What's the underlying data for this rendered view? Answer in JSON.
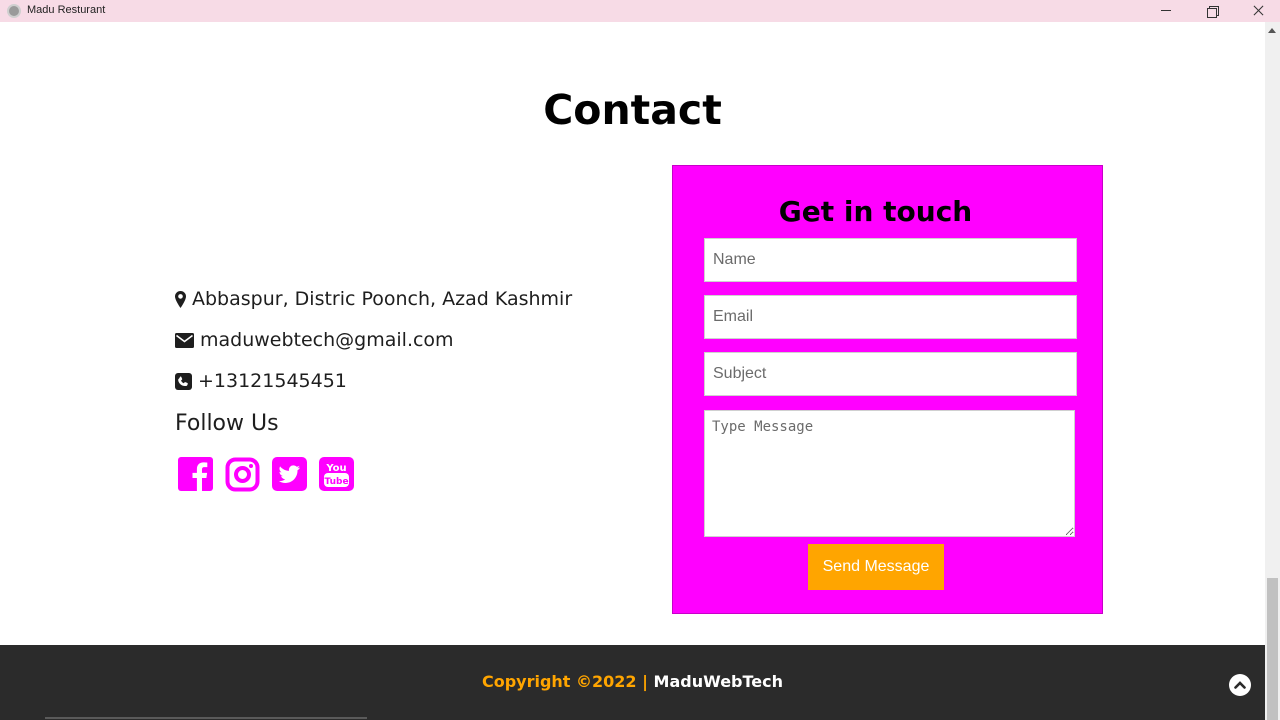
{
  "window": {
    "title": "Madu Resturant"
  },
  "page": {
    "heading": "Contact"
  },
  "contact": {
    "address": "Abbaspur, Distric Poonch, Azad Kashmir",
    "email": "maduwebtech@gmail.com",
    "phone": "+13121545451",
    "follow_title": "Follow Us",
    "socials": [
      {
        "name": "Facebook",
        "icon": "facebook-icon"
      },
      {
        "name": "Instagram",
        "icon": "instagram-icon"
      },
      {
        "name": "Twitter",
        "icon": "twitter-icon"
      },
      {
        "name": "YouTube",
        "icon": "youtube-icon"
      }
    ]
  },
  "form": {
    "title": "Get in touch",
    "name_placeholder": "Name",
    "email_placeholder": "Email",
    "subject_placeholder": "Subject",
    "message_placeholder": "Type Message",
    "send_label": "Send Message"
  },
  "footer": {
    "copyright_prefix": "Copyright ©2022 |",
    "brand": "MaduWebTech"
  },
  "colors": {
    "accent_magenta": "#ff00ff",
    "accent_orange": "#ffa500",
    "footer_bg": "#2b2b2b",
    "titlebar_bg": "#f7dbe6"
  }
}
